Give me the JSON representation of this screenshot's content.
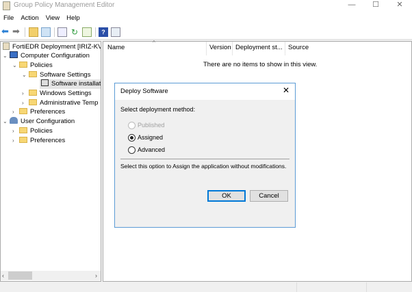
{
  "window": {
    "title": "Group Policy Management Editor",
    "minimize": "—",
    "maximize": "☐",
    "close": "✕"
  },
  "menu": [
    "File",
    "Action",
    "View",
    "Help"
  ],
  "toolbar": [
    "back-icon",
    "forward-icon",
    "up-folder-icon",
    "show-hide-tree-icon",
    "properties-icon",
    "refresh-icon",
    "export-icon",
    "help-icon",
    "action-pane-icon"
  ],
  "tree": [
    {
      "label": "FortiEDR Deployment [IRIZ-KVM",
      "level": 0,
      "chevron": "",
      "icon": "policy"
    },
    {
      "label": "Computer Configuration",
      "level": 0,
      "chevron": "⌄",
      "icon": "computer"
    },
    {
      "label": "Policies",
      "level": 1,
      "chevron": "⌄",
      "icon": "folder"
    },
    {
      "label": "Software Settings",
      "level": 2,
      "chevron": "⌄",
      "icon": "folder"
    },
    {
      "label": "Software installat",
      "level": 3,
      "chevron": "",
      "icon": "software",
      "selected": true
    },
    {
      "label": "Windows Settings",
      "level": 2,
      "chevron": "›",
      "icon": "folder"
    },
    {
      "label": "Administrative Temp",
      "level": 2,
      "chevron": "›",
      "icon": "folder"
    },
    {
      "label": "Preferences",
      "level": 1,
      "chevron": "›",
      "icon": "folder"
    },
    {
      "label": "User Configuration",
      "level": 0,
      "chevron": "⌄",
      "icon": "user"
    },
    {
      "label": "Policies",
      "level": 1,
      "chevron": "›",
      "icon": "folder"
    },
    {
      "label": "Preferences",
      "level": 1,
      "chevron": "›",
      "icon": "folder"
    }
  ],
  "list": {
    "columns": [
      "Name",
      "Version",
      "Deployment st...",
      "Source"
    ],
    "empty": "There are no items to show in this view."
  },
  "dialog": {
    "title": "Deploy Software",
    "prompt": "Select deployment method:",
    "options": [
      {
        "label": "Published",
        "disabled": true,
        "checked": false
      },
      {
        "label": "Assigned",
        "disabled": false,
        "checked": true
      },
      {
        "label": "Advanced",
        "disabled": false,
        "checked": false
      }
    ],
    "description": "Select this option to Assign the application without modifications.",
    "ok": "OK",
    "cancel": "Cancel"
  }
}
